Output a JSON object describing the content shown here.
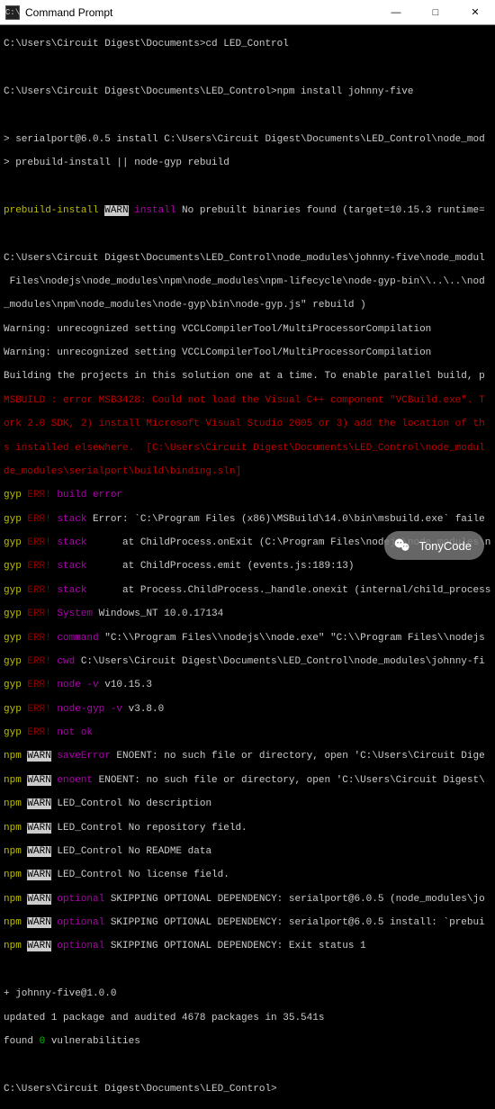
{
  "titlebar": {
    "title": "Command Prompt"
  },
  "buttons": {
    "min": "—",
    "max": "□",
    "close": "✕"
  },
  "wechat": {
    "label": "TonyCode"
  },
  "t": {
    "p1": "C:\\Users\\Circuit Digest\\Documents>",
    "c1": "cd LED_Control",
    "p2": "C:\\Users\\Circuit Digest\\Documents\\LED_Control>",
    "c2": "npm install johnny-five",
    "l3": "> serialport@6.0.5 install C:\\Users\\Circuit Digest\\Documents\\LED_Control\\node_mod",
    "l4": "> prebuild-install || node-gyp rebuild",
    "pi": "prebuild-install ",
    "warn": "WARN",
    "inst": " install ",
    "l5b": "No prebuilt binaries found (target=10.15.3 runtime=",
    "l6": "C:\\Users\\Circuit Digest\\Documents\\LED_Control\\node_modules\\johnny-five\\node_modul",
    "l7": " Files\\nodejs\\node_modules\\npm\\node_modules\\npm-lifecycle\\node-gyp-bin\\\\..\\..\\nod",
    "l8": "_modules\\npm\\node_modules\\node-gyp\\bin\\node-gyp.js\" rebuild )",
    "l9": "Warning: unrecognized setting VCCLCompilerTool/MultiProcessorCompilation",
    "l10": "Warning: unrecognized setting VCCLCompilerTool/MultiProcessorCompilation",
    "l11": "Building the projects in this solution one at a time. To enable parallel build, p",
    "r1": "MSBUILD : error MSB3428: Could not load the Visual C++ component \"VCBuild.exe\". T",
    "r2": "ork 2.0 SDK, 2) install Microsoft Visual Studio 2005 or 3) add the location of th",
    "r3": "s installed elsewhere.  [C:\\Users\\Circuit Digest\\Documents\\LED_Control\\node_modul",
    "r4": "de_modules\\serialport\\build\\binding.sln]",
    "gyp": "gyp ",
    "err": "ERR!",
    "be": " build error",
    "stk": " stack",
    "e1": " Error: `C:\\Program Files (x86)\\MSBuild\\14.0\\bin\\msbuild.exe` faile",
    "e2": "      at ChildProcess.onExit (C:\\Program Files\\nodejs\\node_modules\\n",
    "e3": "      at ChildProcess.emit (events.js:189:13)",
    "e4": "      at Process.ChildProcess._handle.onexit (internal/child_process",
    "sys": " System",
    "syst": " Windows_NT 10.0.17134",
    "cmdl": " command",
    "cmdt": " \"C:\\\\Program Files\\\\nodejs\\\\node.exe\" \"C:\\\\Program Files\\\\nodejs",
    "cwd": " cwd",
    "cwdt": " C:\\Users\\Circuit Digest\\Documents\\LED_Control\\node_modules\\johnny-fi",
    "nv": " node -v",
    "nvt": " v10.15.3",
    "ng": " node-gyp -v",
    "ngt": " v3.8.0",
    "nok": " not ok",
    "npm": "npm ",
    "se": " saveError",
    "set": " ENOENT: no such file or directory, open 'C:\\Users\\Circuit Dige",
    "en": " enoent",
    "ent": " ENOENT: no such file or directory, open 'C:\\Users\\Circuit Digest\\",
    "w1": " LED_Control No description",
    "w2": " LED_Control No repository field.",
    "w3": " LED_Control No README data",
    "w4": " LED_Control No license field.",
    "opt": " optional",
    "o1": " SKIPPING OPTIONAL DEPENDENCY: serialport@6.0.5 (node_modules\\jo",
    "o2": " SKIPPING OPTIONAL DEPENDENCY: serialport@6.0.5 install: `prebui",
    "o3": " SKIPPING OPTIONAL DEPENDENCY: Exit status 1",
    "f1": "+ johnny-five@1.0.0",
    "f2": "updated 1 package and audited 4678 packages in 35.541s",
    "f3a": "found ",
    "f3b": "0",
    "f3c": " vulnerabilities",
    "p3": "C:\\Users\\Circuit Digest\\Documents\\LED_Control>"
  }
}
